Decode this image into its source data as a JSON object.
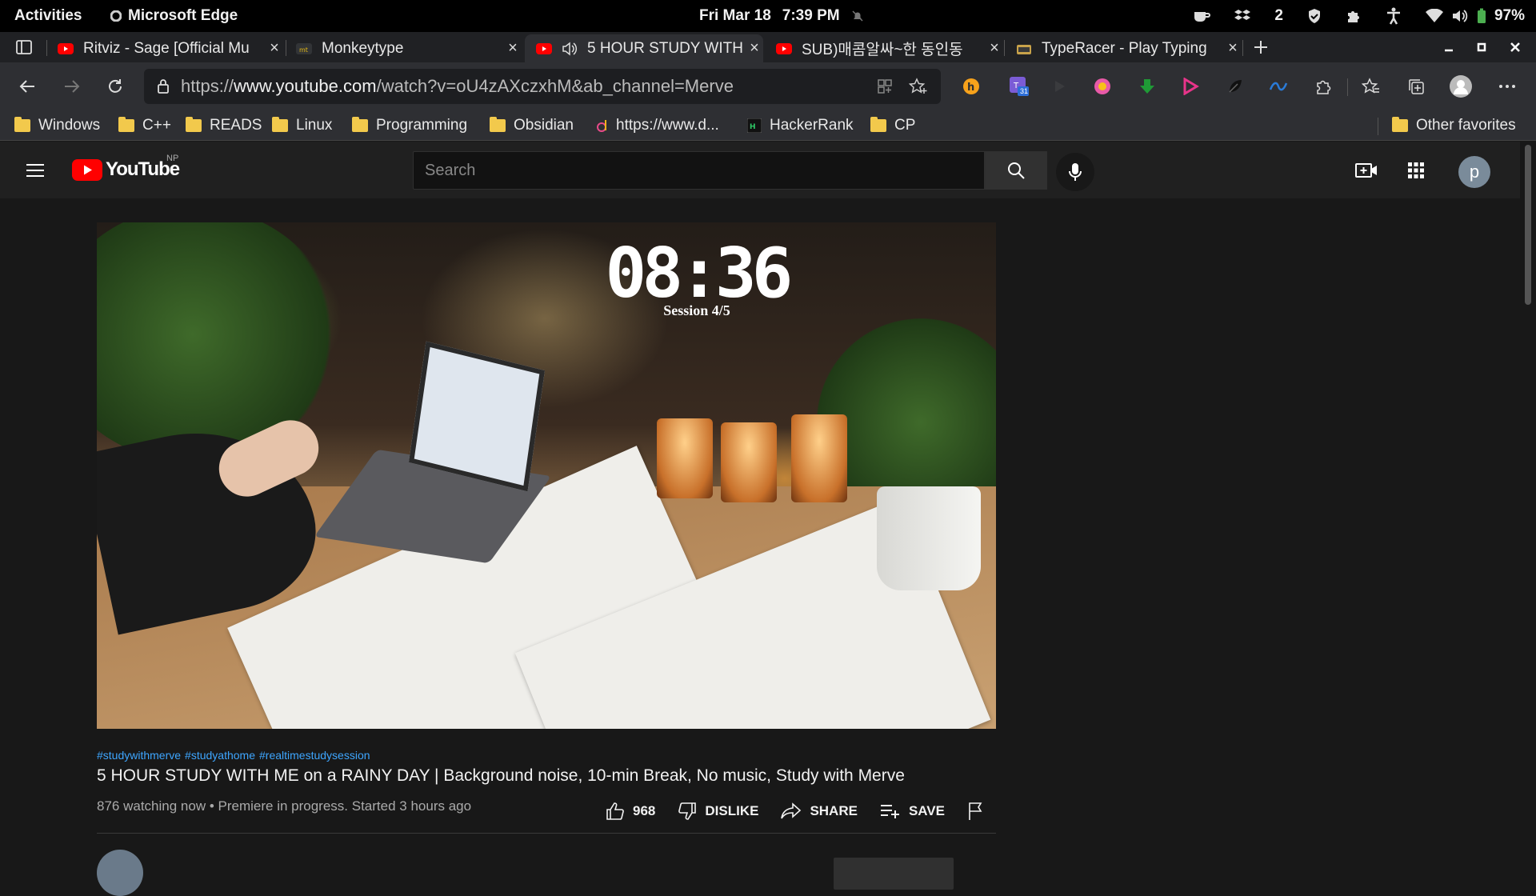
{
  "system_bar": {
    "activities": "Activities",
    "app_name": "Microsoft Edge",
    "date": "Fri Mar 18",
    "time": "7:39 PM",
    "notification_count": "2",
    "battery": "97%"
  },
  "tabs": [
    {
      "title": "Ritviz - Sage [Official Mu",
      "favicon": "youtube-icon",
      "active": false
    },
    {
      "title": "Monkeytype",
      "favicon": "monkeytype-icon",
      "active": false
    },
    {
      "title": "5 HOUR STUDY WITH",
      "favicon": "youtube-icon",
      "active": true,
      "audio": true
    },
    {
      "title": "SUB)매콤알싸~한 동인동",
      "favicon": "youtube-icon",
      "active": false
    },
    {
      "title": "TypeRacer - Play Typing",
      "favicon": "typeracer-icon",
      "active": false
    }
  ],
  "address_bar": {
    "url_prefix": "https://",
    "url_domain": "www.youtube.com",
    "url_path": "/watch?v=oU4zAXczxhM&ab_channel=Merve"
  },
  "extensions": {
    "calendar_badge": "31"
  },
  "bookmarks": [
    {
      "label": "Windows",
      "type": "folder"
    },
    {
      "label": "C++",
      "type": "folder"
    },
    {
      "label": "READS",
      "type": "folder"
    },
    {
      "label": "Linux",
      "type": "folder"
    },
    {
      "label": "Programming",
      "type": "folder"
    },
    {
      "label": "Obsidian",
      "type": "folder"
    },
    {
      "label": "https://www.d...",
      "type": "link"
    },
    {
      "label": "HackerRank",
      "type": "link"
    },
    {
      "label": "CP",
      "type": "folder"
    }
  ],
  "other_favorites": "Other favorites",
  "youtube": {
    "wordmark": "YouTube",
    "country_code": "NP",
    "search_placeholder": "Search",
    "avatar_letter": "p",
    "video": {
      "timer": "08:36",
      "session": "Session 4/5"
    },
    "hashtags": [
      "#studywithmerve",
      "#studyathome",
      "#realtimestudysession"
    ],
    "title": "5 HOUR STUDY WITH ME on a RAINY DAY | Background noise, 10-min Break, No music, Study with Merve",
    "watching": "876 watching now",
    "premiere": "Premiere in progress. Started 3 hours ago",
    "likes": "968",
    "dislike_label": "DISLIKE",
    "share_label": "SHARE",
    "save_label": "SAVE"
  },
  "colors": {
    "youtube_red": "#ff0000",
    "link_blue": "#3ea6ff",
    "battery_green": "#4caf50"
  }
}
